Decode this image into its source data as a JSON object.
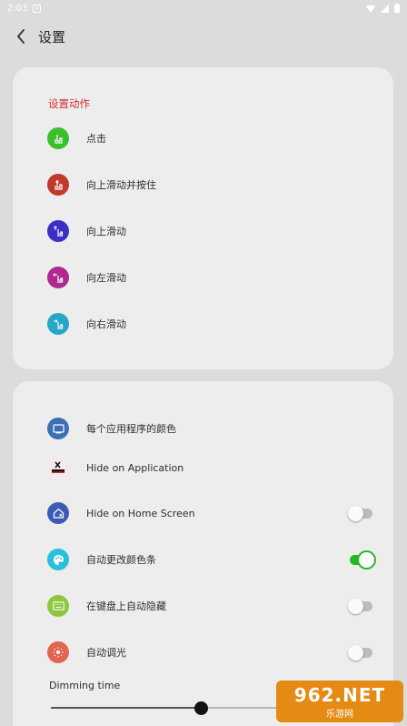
{
  "status_bar": {
    "time": "2:03",
    "box_label": "×",
    "icons": [
      "wifi-icon",
      "signal-icon",
      "battery-icon"
    ]
  },
  "app_bar": {
    "title": "设置"
  },
  "actions_section": {
    "title": "设置动作",
    "items": [
      {
        "label": "点击",
        "icon": "tap-icon",
        "color": "#3bbf2c"
      },
      {
        "label": "向上滑动并按住",
        "icon": "swipe-up-hold-icon",
        "color": "#c0392b"
      },
      {
        "label": "向上滑动",
        "icon": "swipe-up-icon",
        "color": "#3b2fc4"
      },
      {
        "label": "向左滑动",
        "icon": "swipe-left-icon",
        "color": "#b0298f"
      },
      {
        "label": "向右滑动",
        "icon": "swipe-right-icon",
        "color": "#25a7c7"
      }
    ]
  },
  "settings_section": {
    "items": [
      {
        "label": "每个应用程序的颜色",
        "icon": "app-color-icon",
        "color": "#3d6fb5"
      },
      {
        "label": "Hide on Application",
        "icon": "hide-app-icon",
        "color": "#f5e9e9"
      },
      {
        "label": "Hide on Home Screen",
        "icon": "home-hide-icon",
        "color": "#3e5bb3",
        "toggle": false
      },
      {
        "label": "自动更改颜色条",
        "icon": "palette-icon",
        "color": "#29c0dc",
        "toggle": true
      },
      {
        "label": "在键盘上自动隐藏",
        "icon": "keyboard-icon",
        "color": "#8dc63f",
        "toggle": false
      },
      {
        "label": "自动调光",
        "icon": "brightness-icon",
        "color": "#e2654f",
        "toggle": false
      }
    ],
    "dimming_label": "Dimming time",
    "dimming_value": 0.5
  },
  "watermark": {
    "big": "962.NET",
    "small": "乐游网"
  }
}
